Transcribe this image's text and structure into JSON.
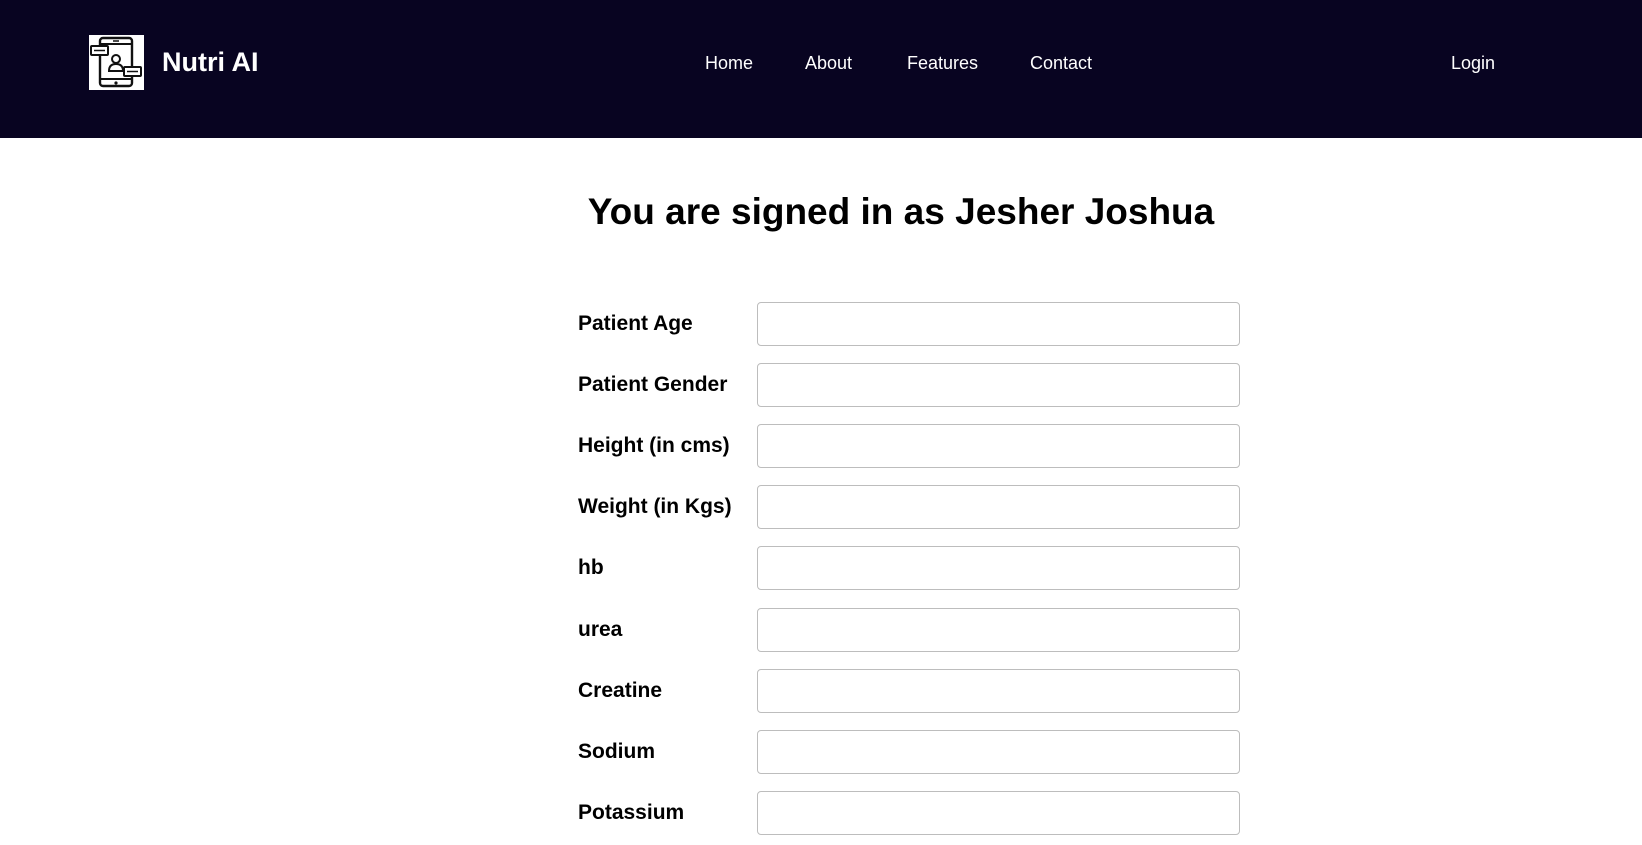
{
  "navbar": {
    "logo_icon": "tablet-user-chat-icon",
    "brand_name": "Nutri AI",
    "links": {
      "home": "Home",
      "about": "About",
      "features": "Features",
      "contact": "Contact"
    },
    "login": "Login",
    "background_color": "#080421"
  },
  "main": {
    "signed_in_text": "You are signed in as Jesher Joshua"
  },
  "form": {
    "fields": [
      {
        "label": "Patient Age",
        "value": ""
      },
      {
        "label": "Patient Gender",
        "value": ""
      },
      {
        "label": "Height (in cms)",
        "value": ""
      },
      {
        "label": "Weight (in Kgs)",
        "value": ""
      },
      {
        "label": "hb",
        "value": ""
      },
      {
        "label": "urea",
        "value": ""
      },
      {
        "label": "Creatine",
        "value": ""
      },
      {
        "label": "Sodium",
        "value": ""
      },
      {
        "label": "Potassium",
        "value": ""
      }
    ]
  }
}
